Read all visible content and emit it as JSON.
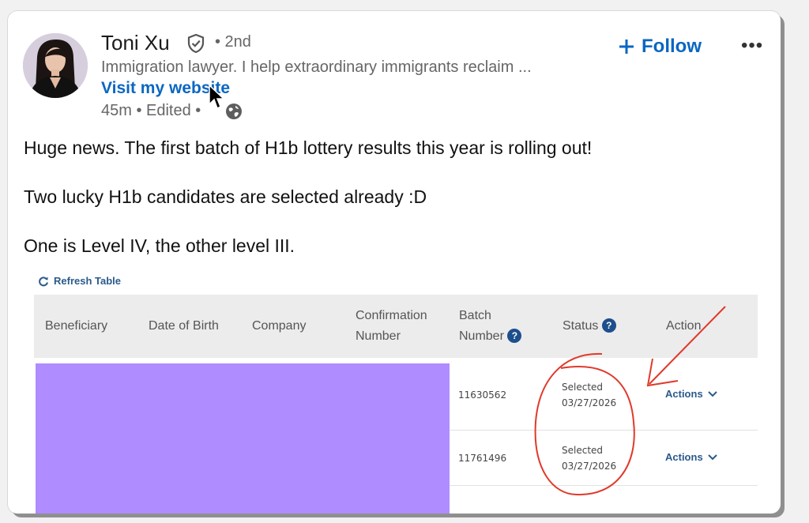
{
  "post": {
    "author_name": "Toni Xu",
    "degree": "• 2nd",
    "headline": "Immigration lawyer. I help extraordinary immigrants reclaim ...",
    "website_label": "Visit my website",
    "meta": "45m • Edited •",
    "follow_label": "Follow",
    "more_label": "•••",
    "paragraphs": [
      "Huge news. The first batch of H1b lottery results this year is rolling out!",
      "Two lucky H1b candidates are selected already :D",
      "One is Level IV, the other level III."
    ]
  },
  "table": {
    "refresh_label": "Refresh Table",
    "headers": {
      "beneficiary": "Beneficiary",
      "dob": "Date of Birth",
      "company": "Company",
      "confirmation_1": "Confirmation",
      "confirmation_2": "Number",
      "batch_1": "Batch",
      "batch_2": "Number",
      "status": "Status",
      "action": "Action"
    },
    "rows": [
      {
        "batch": "11630562",
        "status": "Selected",
        "date": "03/27/2026",
        "action": "Actions"
      },
      {
        "batch": "11761496",
        "status": "Selected",
        "date": "03/27/2026",
        "action": "Actions"
      }
    ]
  },
  "colors": {
    "link_blue": "#0a66c2",
    "table_link": "#2a5a8c",
    "redaction": "#af8cff",
    "annotation_red": "#e0392b"
  },
  "icons": [
    "verified-shield-icon",
    "globe-icon",
    "plus-icon",
    "refresh-icon",
    "help-icon",
    "chevron-down-icon",
    "cursor-icon"
  ]
}
